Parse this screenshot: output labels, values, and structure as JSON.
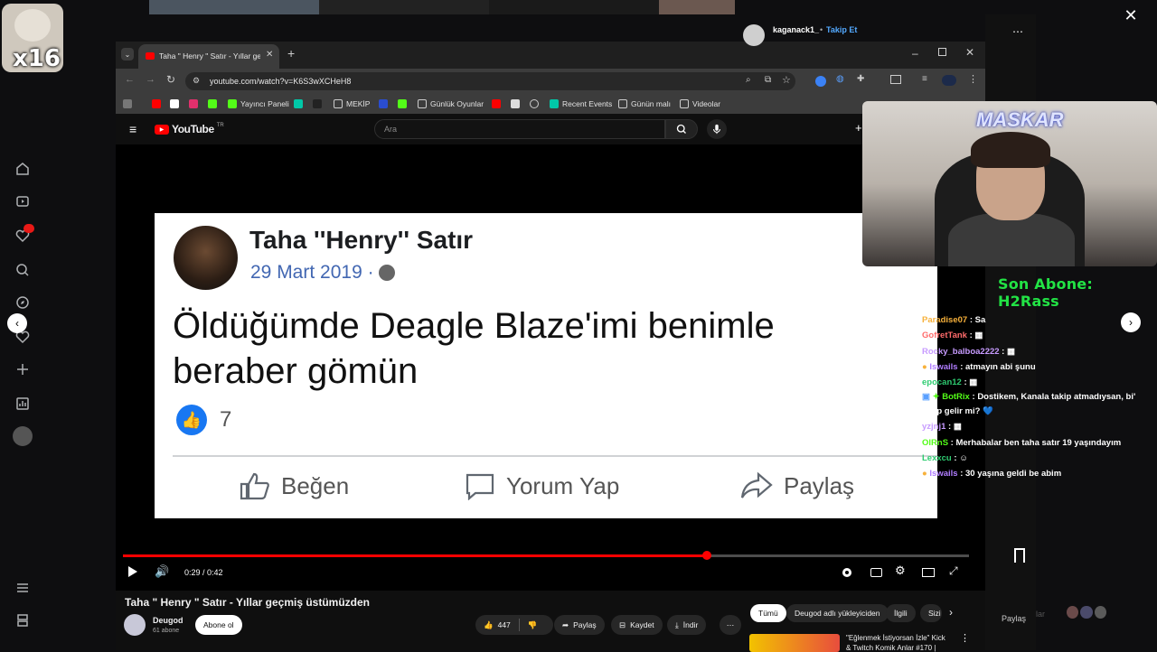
{
  "sticker": {
    "label": "x16"
  },
  "browser": {
    "tab_title": "Taha \" Henry \" Satır - Yıllar geçm",
    "url": "youtube.com/watch?v=K6S3wXCHeH8",
    "bookmarks": [
      {
        "label": "Yayıncı Paneli"
      },
      {
        "label": "MEKİP"
      },
      {
        "label": "Günlük Oyunlar"
      },
      {
        "label": "Recent Events"
      },
      {
        "label": "Günün malı"
      },
      {
        "label": "Videolar"
      }
    ]
  },
  "youtube": {
    "logo": "YouTube",
    "region": "TR",
    "search_placeholder": "Ara"
  },
  "post": {
    "name": "Taha ''Henry'' Satır",
    "date": "29 Mart 2019 · ",
    "text": "Öldüğümde Deagle Blaze'imi benimle beraber gömün",
    "likes": "7",
    "actions": [
      "Beğen",
      "Yorum Yap",
      "Paylaş"
    ]
  },
  "player": {
    "time": "0:29 / 0:42",
    "progress": 0.69
  },
  "video": {
    "title": "Taha \" Henry \" Satır - Yıllar geçmiş üstümüzden",
    "channel": "Deugod",
    "subscribers": "61 abone",
    "subscribe": "Abone ol",
    "like_count": "447",
    "share": "Paylaş",
    "save": "Kaydet",
    "download": "İndir"
  },
  "related": {
    "chips": [
      "Tümü",
      "Deugod adlı yükleyiciden",
      "İlgili",
      "Sizi"
    ],
    "first_title": "\"Eğlenmek İstiyorsan İzle\" Kick",
    "first_sub": "& Twitch Komik Anlar #170 |"
  },
  "stream": {
    "streamer": "kaganack1_",
    "follow": "Takip Et",
    "webcam_logo": "MASKAR",
    "last_sub": "Son Abone: H2Rass",
    "share": "Paylaş",
    "share_ghost": "lar"
  },
  "chat": [
    {
      "user": "Paradise07",
      "color": "#f7b13b",
      "text": "Sa"
    },
    {
      "user": "GofretTank",
      "color": "#ff6b6b",
      "text": "▦"
    },
    {
      "user": "Rocky_balboa2222",
      "color": "#c79bff",
      "text": "▦"
    },
    {
      "user": "Iswails",
      "color": "#b07dff",
      "text": "atmayın abi şunu"
    },
    {
      "user": "epocan12",
      "color": "#2ecc71",
      "text": "▦"
    },
    {
      "user": "BotRix",
      "color": "#53fc18",
      "text": "Dostikem, Kanala takip atmadıysan, bi' takip gelir mi? 💙"
    },
    {
      "user": "yzjnj1",
      "color": "#c79bff",
      "text": "▦"
    },
    {
      "user": "OlRnS",
      "color": "#53fc18",
      "text": "Merhabalar ben taha satır 19 yaşındayım"
    },
    {
      "user": "Lexxcu",
      "color": "#2ecc71",
      "text": "☺"
    },
    {
      "user": "Iswails",
      "color": "#b07dff",
      "text": "30 yaşına geldi be abim"
    }
  ]
}
